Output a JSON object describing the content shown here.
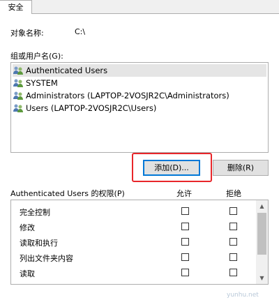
{
  "tab": {
    "label": "安全"
  },
  "object": {
    "label": "对象名称:",
    "value": "C:\\"
  },
  "groups_label": "组或用户名(G):",
  "groups": [
    {
      "name": "Authenticated Users",
      "selected": true
    },
    {
      "name": "SYSTEM",
      "selected": false
    },
    {
      "name": "Administrators (LAPTOP-2VOSJR2C\\Administrators)",
      "selected": false
    },
    {
      "name": "Users (LAPTOP-2VOSJR2C\\Users)",
      "selected": false
    }
  ],
  "buttons": {
    "add": "添加(D)...",
    "remove": "删除(R)"
  },
  "permissions": {
    "header": "Authenticated Users 的权限(P)",
    "allow": "允许",
    "deny": "拒绝",
    "rows": [
      {
        "name": "完全控制",
        "allow": false,
        "deny": false
      },
      {
        "name": "修改",
        "allow": false,
        "deny": false
      },
      {
        "name": "读取和执行",
        "allow": false,
        "deny": false
      },
      {
        "name": "列出文件夹内容",
        "allow": false,
        "deny": false
      },
      {
        "name": "读取",
        "allow": false,
        "deny": false
      }
    ]
  },
  "watermark": "yunhu.net",
  "colors": {
    "highlight": "#e8262a",
    "selected_row": "#e5e5e5",
    "focus": "#0078d7"
  }
}
